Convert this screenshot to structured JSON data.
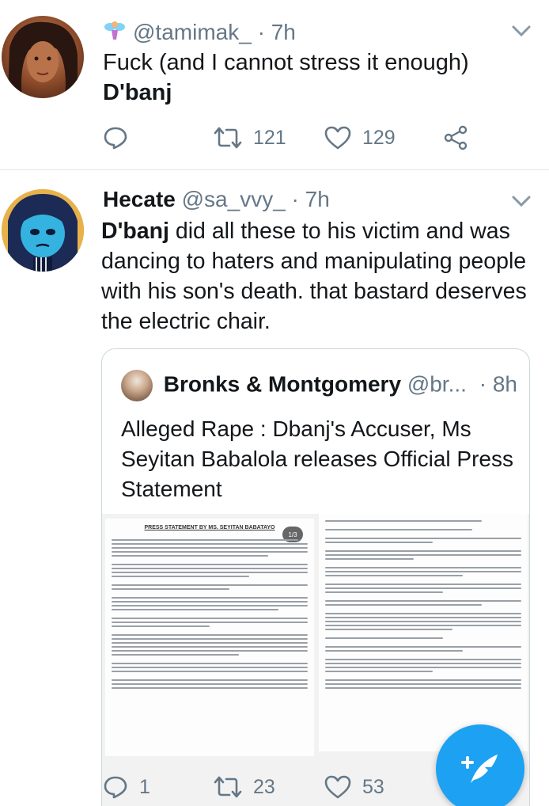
{
  "tweets": [
    {
      "display_name": "",
      "emoji_icon": "fairy-emoji",
      "handle": "@tamimak_",
      "sep": "·",
      "time": "7h",
      "line1": "Fuck (and I cannot stress it enough)",
      "line2": "D'banj",
      "replies": "",
      "retweets": "121",
      "likes": "129"
    },
    {
      "display_name": "Hecate",
      "handle": "@sa_vvy_",
      "sep": "·",
      "time": "7h",
      "text_bold": "D'banj",
      "text_rest": " did all these to his victim and was dancing to haters and manipulating people with his son's death. that bastard deserves the electric chair.",
      "replies": "1",
      "retweets": "23",
      "likes": "53"
    }
  ],
  "quote": {
    "display_name": "Bronks & Montgomery",
    "handle": "@br...",
    "sep": "·",
    "time": "8h",
    "text": "Alleged Rape : Dbanj's Accuser, Ms Seyitan Babalola releases Official Press Statement",
    "doc_title": "PRESS STATEMENT BY MS. SEYITAN BABATAYO",
    "page_badge": "1/3"
  },
  "icons": {
    "reply": "reply-icon",
    "retweet": "retweet-icon",
    "like": "heart-icon",
    "share": "share-icon",
    "chevron": "chevron-down-icon",
    "compose": "compose-tweet-icon"
  },
  "colors": {
    "accent": "#1da1f2",
    "muted": "#657786",
    "text": "#14171a"
  }
}
